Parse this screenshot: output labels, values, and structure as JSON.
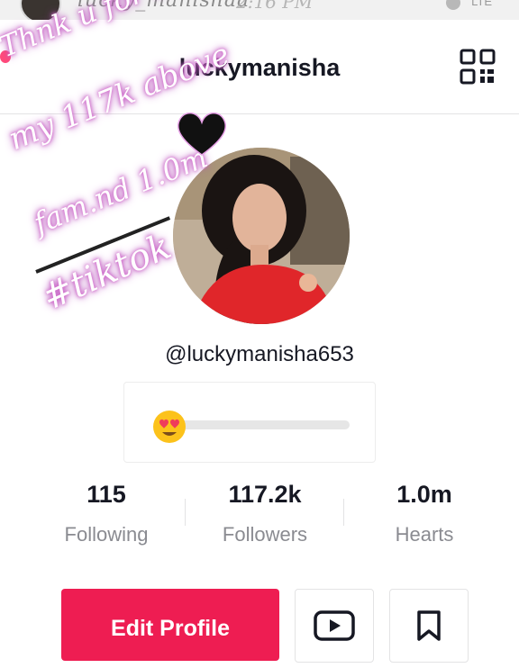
{
  "status_bar": {
    "handle": "lucky_manishaa",
    "time": "2:16 PM",
    "network": "LTE"
  },
  "header": {
    "username": "luckymanisha",
    "qr_icon": "qr-code-icon"
  },
  "overlay": {
    "line1": "Thnk u for being",
    "line2": "my 117k above",
    "line3": "fam.nd 1.0m",
    "line4": "#tiktok",
    "heart_color": "#111111",
    "glow_color": "#c05cc0"
  },
  "profile": {
    "handle": "@luckymanisha653",
    "bio_emoji": "heart-eyes-emoji"
  },
  "stats": {
    "following": {
      "value": "115",
      "label": "Following"
    },
    "followers": {
      "value": "117.2k",
      "label": "Followers"
    },
    "hearts": {
      "value": "1.0m",
      "label": "Hearts"
    }
  },
  "actions": {
    "edit_profile": "Edit Profile",
    "youtube_icon": "youtube-icon",
    "bookmark_icon": "bookmark-icon"
  },
  "colors": {
    "accent": "#ee1d52",
    "secondary_text": "#8a8b91"
  }
}
